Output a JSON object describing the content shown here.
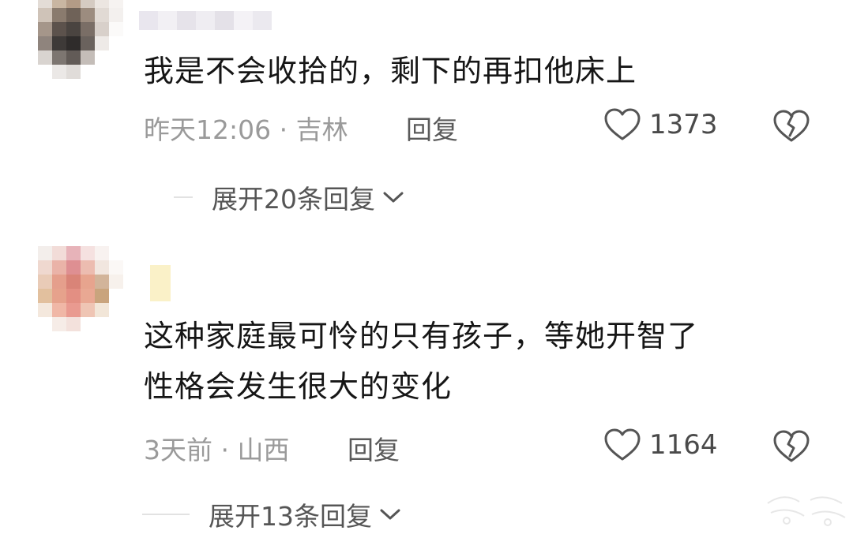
{
  "comments": [
    {
      "text": "我是不会收拾的，剩下的再扣他床上",
      "meta": "昨天12:06 · 吉林",
      "reply_label": "回复",
      "likes": "1373",
      "expand_label": "展开20条回复"
    },
    {
      "text_line1": "这种家庭最可怜的只有孩子，等她开智了",
      "text_line2": "性格会发生很大的变化",
      "meta": "3天前 · 山西",
      "reply_label": "回复",
      "likes": "1164",
      "expand_label": "展开13条回复"
    }
  ],
  "icons": {
    "like": "heart-outline-icon",
    "dislike": "broken-heart-icon",
    "expand": "chevron-down-icon"
  },
  "colors": {
    "text": "#161616",
    "meta": "#9a9a9a",
    "action": "#555555",
    "icon": "#555555"
  }
}
